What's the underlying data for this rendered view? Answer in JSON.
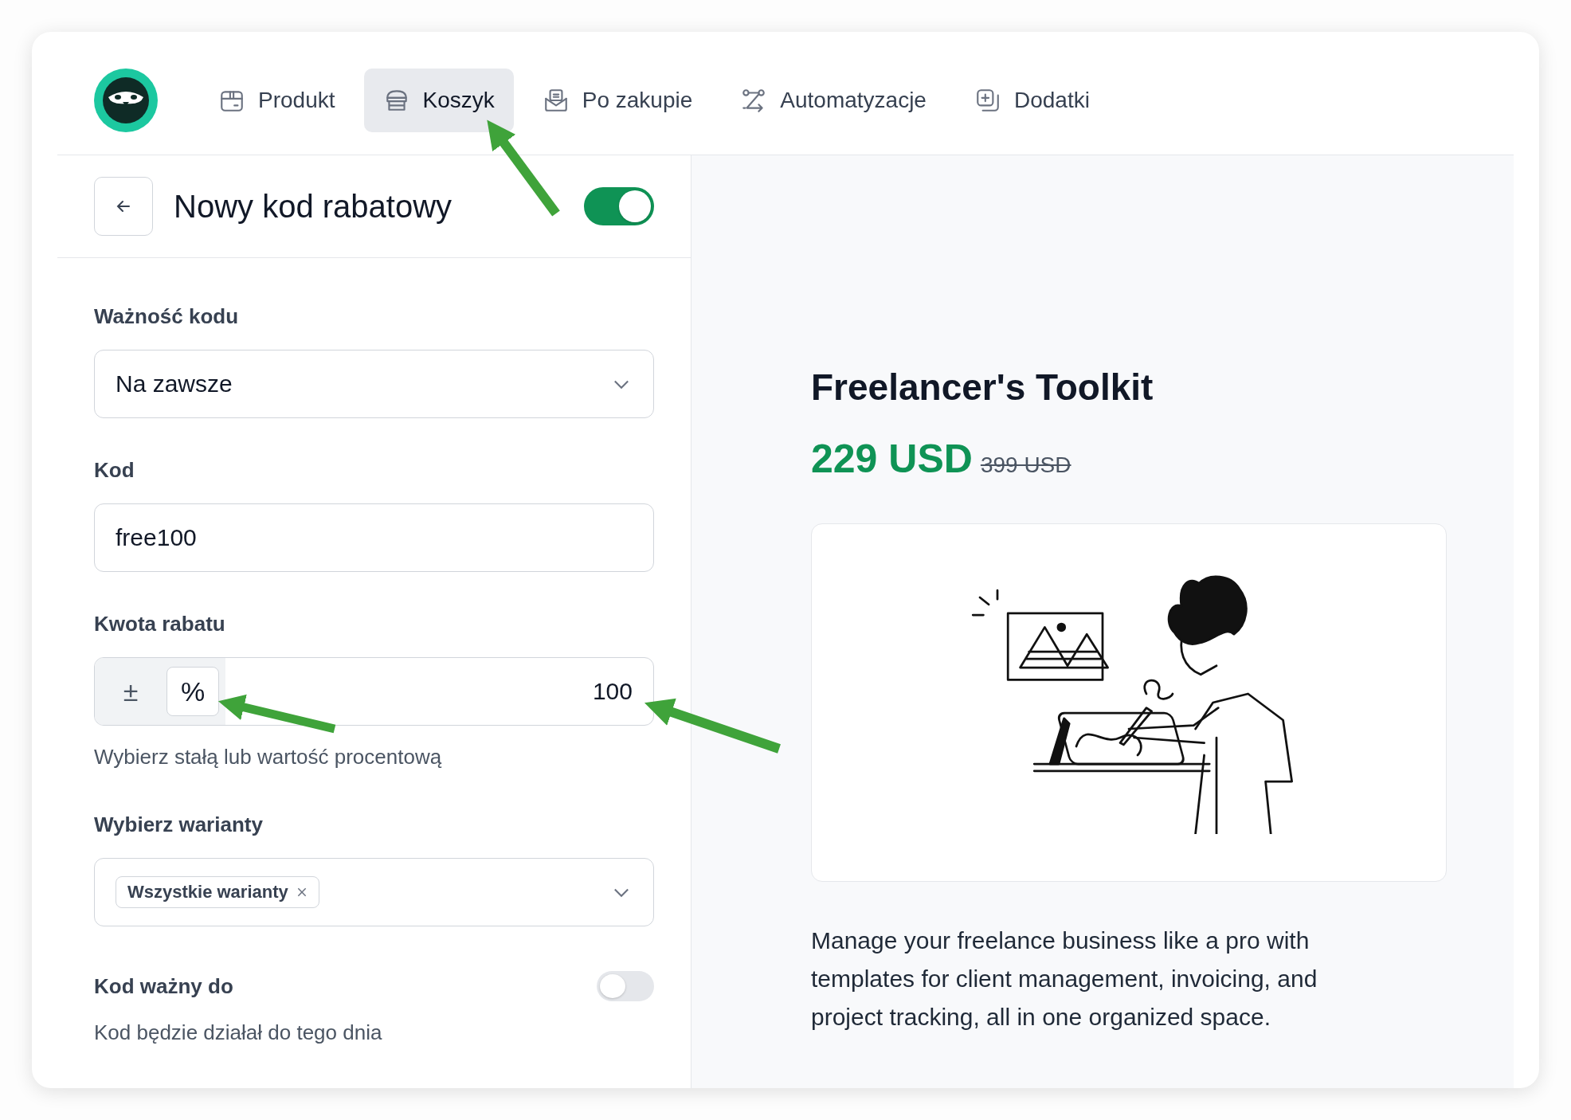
{
  "nav": {
    "tabs": [
      {
        "label": "Produkt",
        "kind": "box",
        "selected": false
      },
      {
        "label": "Koszyk",
        "kind": "store",
        "selected": true
      },
      {
        "label": "Po zakupie",
        "kind": "mail",
        "selected": false
      },
      {
        "label": "Automatyzacje",
        "kind": "route",
        "selected": false
      },
      {
        "label": "Dodatki",
        "kind": "plus",
        "selected": false
      }
    ]
  },
  "editor": {
    "title": "Nowy kod rabatowy",
    "active": true,
    "validity": {
      "label": "Ważność kodu",
      "value": "Na zawsze"
    },
    "code": {
      "label": "Kod",
      "value": "free100"
    },
    "amount": {
      "label": "Kwota rabatu",
      "modes": [
        {
          "symbol": "±",
          "selected": false
        },
        {
          "symbol": "%",
          "selected": true
        }
      ],
      "value": "100",
      "hint": "Wybierz stałą lub wartość procentową"
    },
    "variants": {
      "label": "Wybierz warianty",
      "chips": [
        "Wszystkie warianty"
      ]
    },
    "expiry": {
      "label": "Kod ważny do",
      "on": false,
      "hint": "Kod będzie działał do tego dnia"
    }
  },
  "preview": {
    "title": "Freelancer's Toolkit",
    "price": "229 USD",
    "old_price": "399 USD",
    "image": {
      "kind": "illustration"
    },
    "description": "Manage your freelance business like a pro with templates for client management, invoicing, and project tracking, all in one organized space."
  }
}
